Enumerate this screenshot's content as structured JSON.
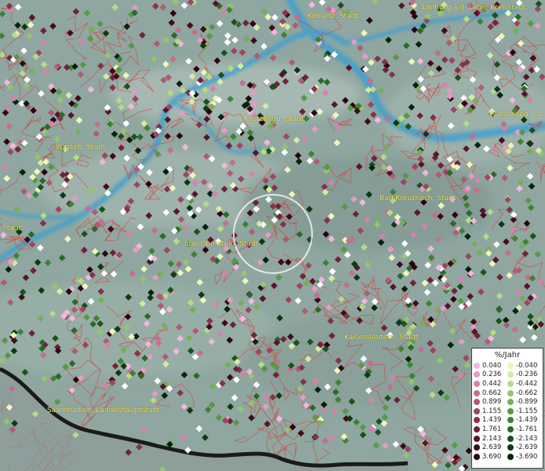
{
  "map": {
    "cities": [
      {
        "id": "koblenz",
        "label": "Koblenz, Stadt"
      },
      {
        "id": "limburg",
        "label": "Limburg a.d. Lahn, Kreisstadt"
      },
      {
        "id": "wiesbaden",
        "label": "Wiesbaden, La"
      },
      {
        "id": "kastellaun",
        "label": "Kastellaun, Stadt"
      },
      {
        "id": "wittlich",
        "label": "Wittlich, Stadt"
      },
      {
        "id": "badkreuznach",
        "label": "Bad Kreuznach, Stadt"
      },
      {
        "id": "idaroberstein",
        "label": "Idar-Oberstein, Stadt"
      },
      {
        "id": "kaiserslautern",
        "label": "Kaiserslautern, Stadt"
      },
      {
        "id": "saarbruecken",
        "label": "Saarbrücken, Landeshauptstadt"
      },
      {
        "id": "stadt_left",
        "label": "Stadt"
      }
    ],
    "colors": {
      "terrain": "#8fa7a0",
      "river": "#3c9fd0",
      "boundary": "#d83a3a",
      "label": "#f2e85a",
      "border": "#1a1a1a"
    }
  },
  "legend": {
    "title": "%/Jahr",
    "positive": [
      {
        "value": "0.040",
        "color": "#f3b6de"
      },
      {
        "value": "0.236",
        "color": "#e59ac7"
      },
      {
        "value": "0.442",
        "color": "#d682aa"
      },
      {
        "value": "0.662",
        "color": "#c56e90"
      },
      {
        "value": "0.899",
        "color": "#b25a76"
      },
      {
        "value": "1.155",
        "color": "#9e4560"
      },
      {
        "value": "1.439",
        "color": "#87314a"
      },
      {
        "value": "1.761",
        "color": "#702238"
      },
      {
        "value": "2.143",
        "color": "#581428"
      },
      {
        "value": "2.639",
        "color": "#420b1a"
      },
      {
        "value": "3.690",
        "color": "#2c040e"
      }
    ],
    "negative": [
      {
        "value": "-0.040",
        "color": "#eef7b8"
      },
      {
        "value": "-0.236",
        "color": "#d4ec9e"
      },
      {
        "value": "-0.442",
        "color": "#b5db85"
      },
      {
        "value": "-0.662",
        "color": "#94c66c"
      },
      {
        "value": "-0.899",
        "color": "#74b055"
      },
      {
        "value": "-1.155",
        "color": "#579944"
      },
      {
        "value": "-1.439",
        "color": "#3e8234"
      },
      {
        "value": "-1.761",
        "color": "#2a6a27"
      },
      {
        "value": "-2.143",
        "color": "#1a521b"
      },
      {
        "value": "-2.639",
        "color": "#0d3a11"
      },
      {
        "value": "-3.690",
        "color": "#04230a"
      }
    ]
  }
}
